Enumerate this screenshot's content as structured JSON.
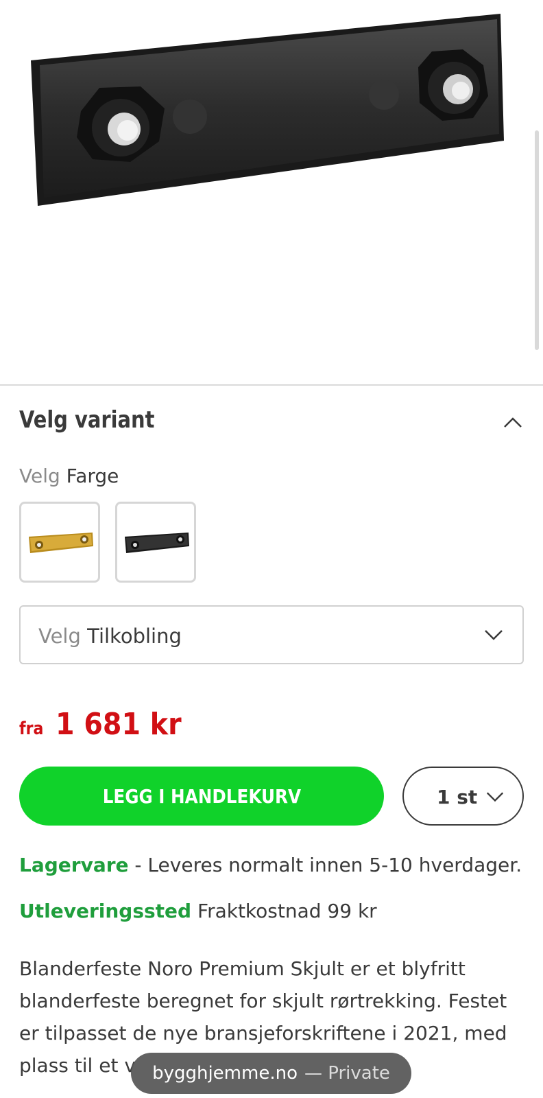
{
  "variant": {
    "title": "Velg variant",
    "color_prefix": "Velg",
    "color_label": "Farge",
    "swatches": [
      "gold",
      "black"
    ],
    "connection_prefix": "Velg",
    "connection_label": "Tilkobling"
  },
  "price": {
    "prefix": "fra",
    "amount": "1 681 kr"
  },
  "cart": {
    "add_label": "LEGG I HANDLEKURV",
    "quantity": "1 st"
  },
  "availability": {
    "stock_label": "Lagervare",
    "stock_text": " - Leveres normalt innen 5-10 hverdager.",
    "pickup_label": "Utleveringssted",
    "pickup_text": " Fraktkostnad 99 kr"
  },
  "description": "Blanderfeste Noro Premium Skjult er et blyfritt blanderfeste beregnet for skjult rørtrekking. Festet er tilpasset de nye bransjeforskriftene i 2021, med plass til et v",
  "browser": {
    "domain": "bygghjemme.no",
    "mode": "— Private"
  },
  "colors": {
    "price_red": "#d10f14",
    "button_green": "#10d22a",
    "label_green": "#1f9e3c"
  }
}
